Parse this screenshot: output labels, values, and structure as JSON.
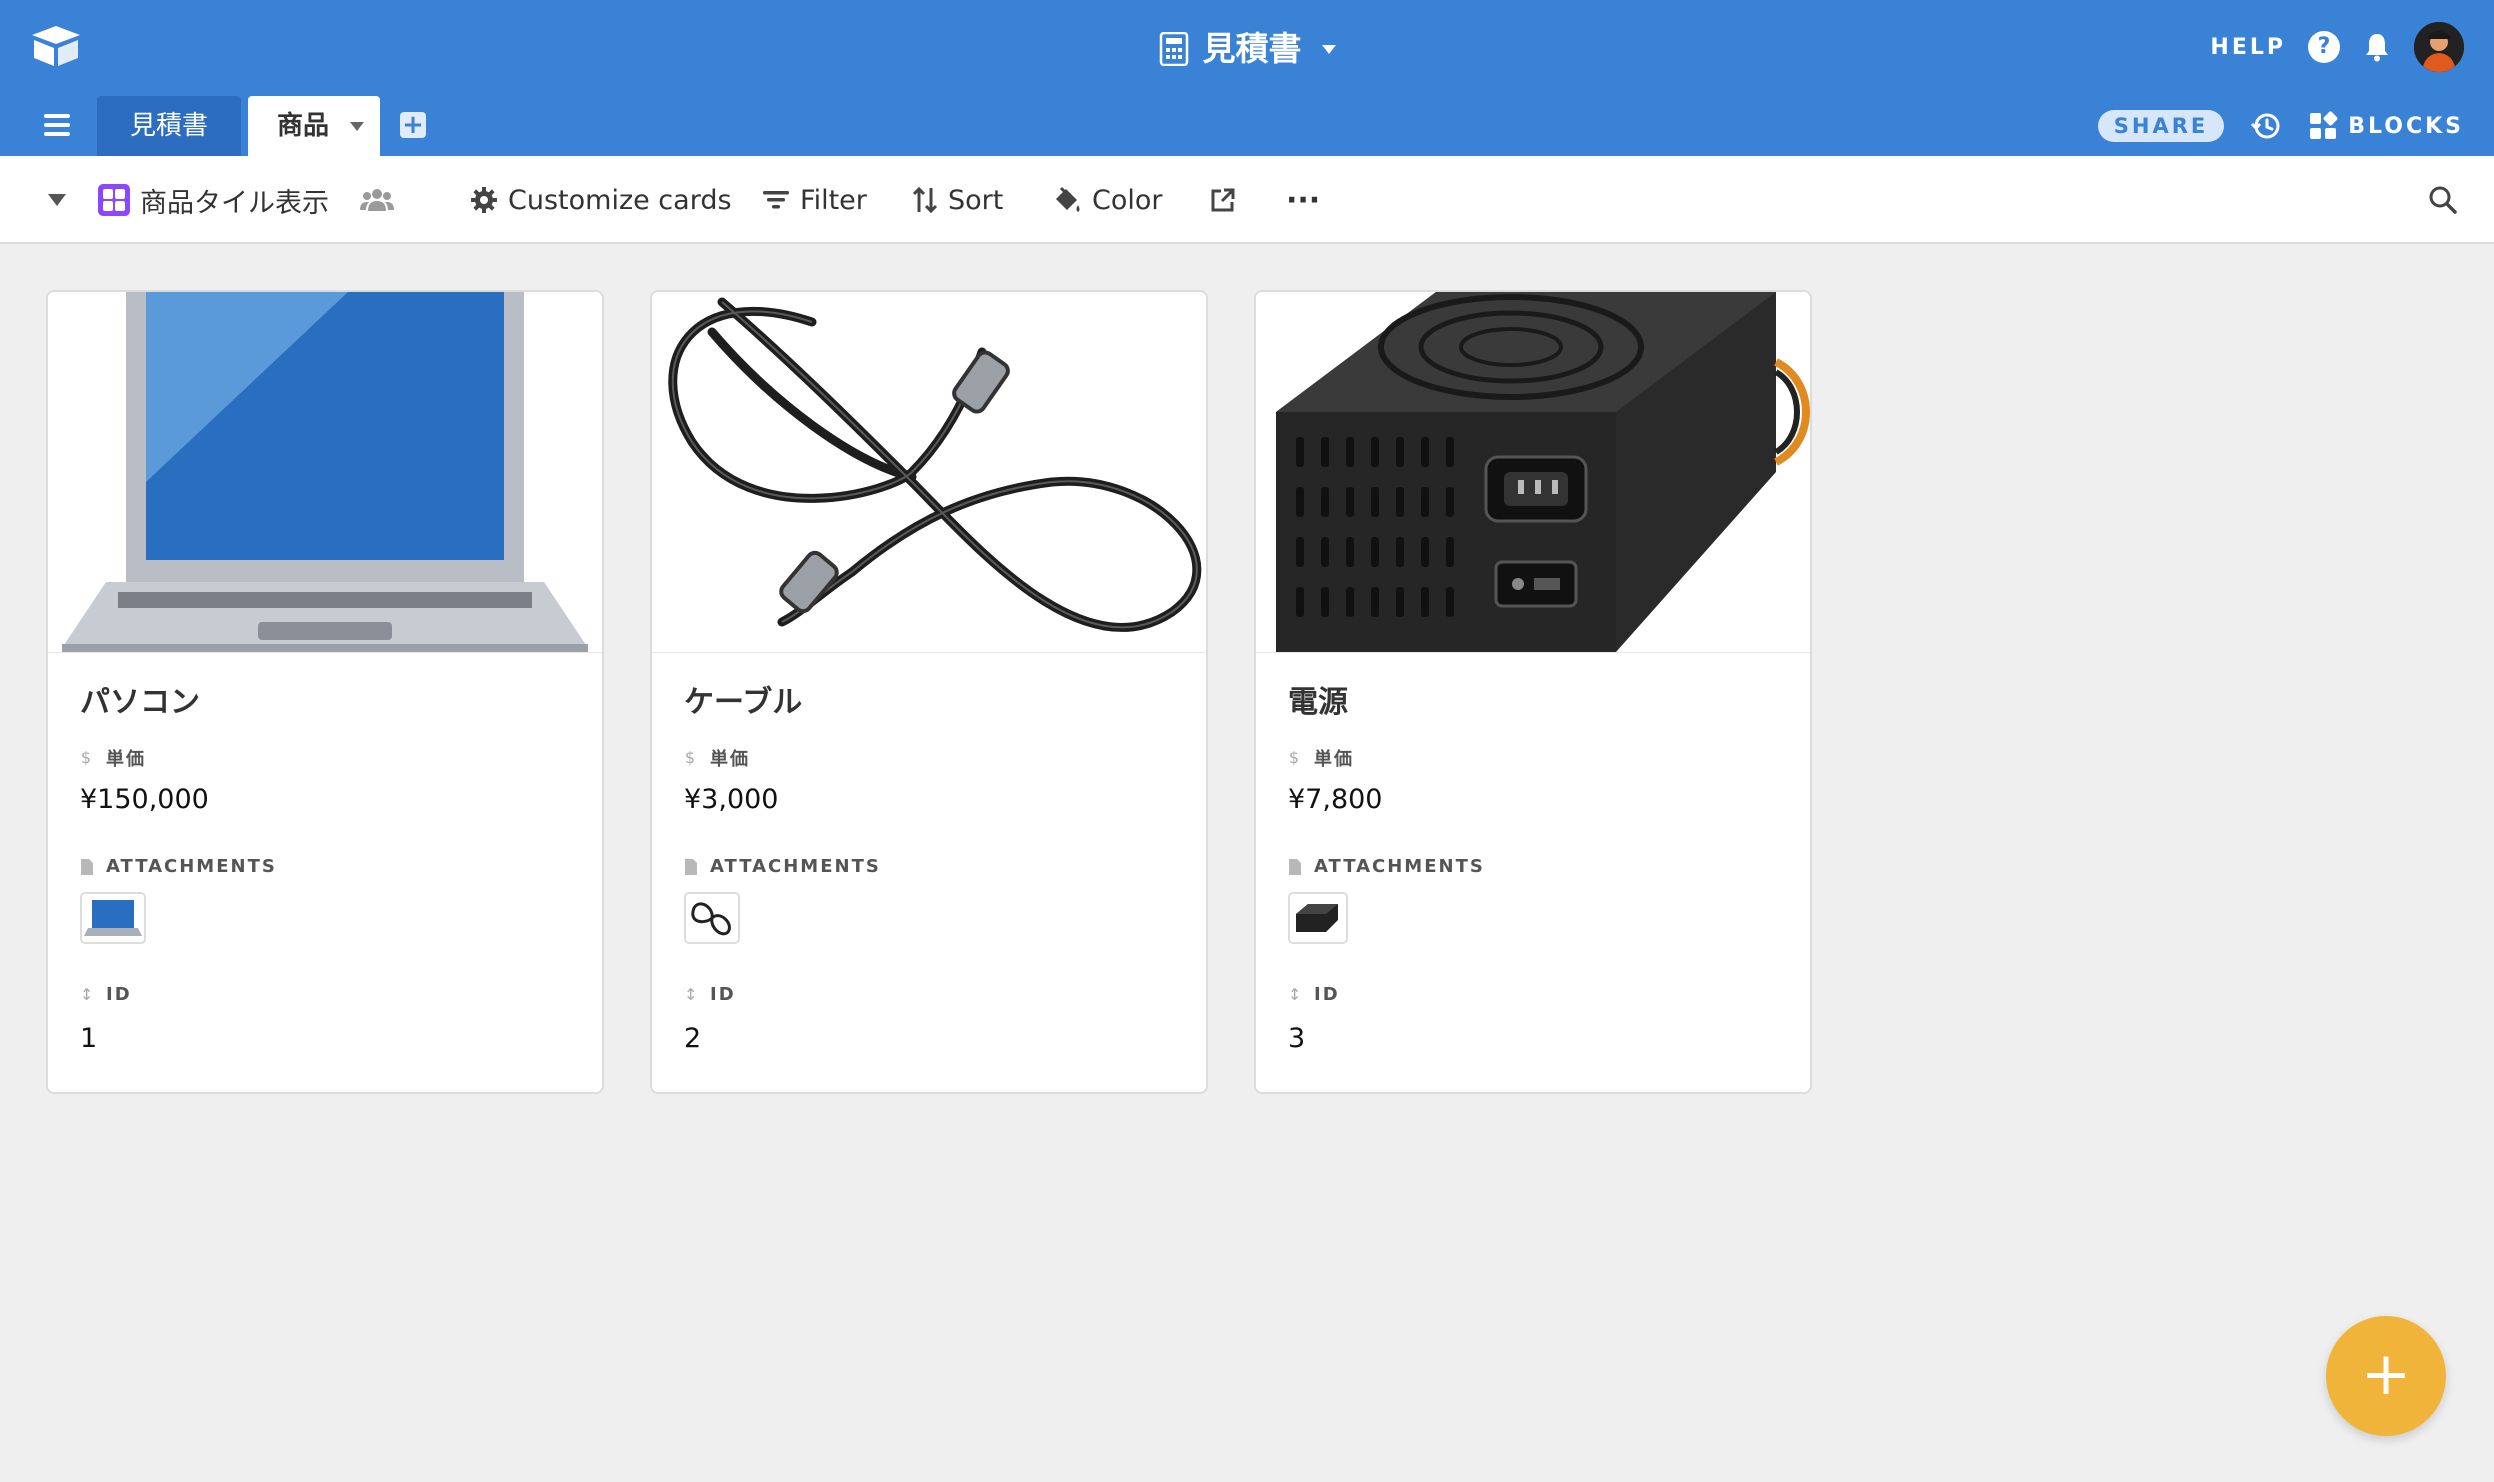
{
  "header": {
    "base_title": "見積書",
    "help_label": "HELP",
    "colors": {
      "topbar": "#3a82d6",
      "fab": "#f0b43a",
      "gallery_icon": "#8b46ff"
    }
  },
  "tabs": [
    {
      "label": "見積書",
      "active": false
    },
    {
      "label": "商品",
      "active": true
    }
  ],
  "tabs_right": {
    "share_label": "SHARE",
    "blocks_label": "BLOCKS"
  },
  "toolbar": {
    "view_name": "商品タイル表示",
    "customize_label": "Customize cards",
    "filter_label": "Filter",
    "sort_label": "Sort",
    "color_label": "Color",
    "more_label": "···"
  },
  "cards": [
    {
      "title": "パソコン",
      "price_label": "単価",
      "price": "¥150,000",
      "attachments_label": "ATTACHMENTS",
      "id_label": "ID",
      "id": "1",
      "image": "laptop-image"
    },
    {
      "title": "ケーブル",
      "price_label": "単価",
      "price": "¥3,000",
      "attachments_label": "ATTACHMENTS",
      "id_label": "ID",
      "id": "2",
      "image": "cable-image"
    },
    {
      "title": "電源",
      "price_label": "単価",
      "price": "¥7,800",
      "attachments_label": "ATTACHMENTS",
      "id_label": "ID",
      "id": "3",
      "image": "power-supply-image"
    }
  ],
  "fab": {
    "label": "+"
  }
}
